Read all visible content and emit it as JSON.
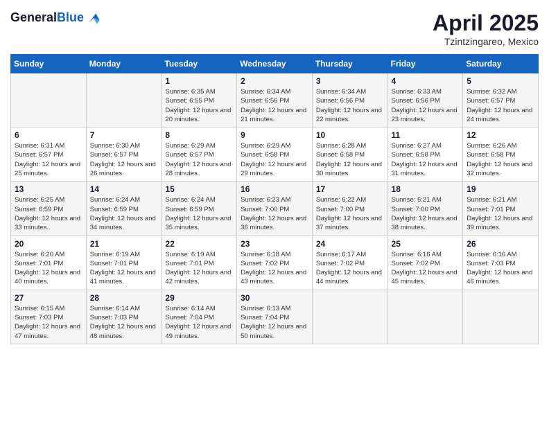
{
  "header": {
    "logo_general": "General",
    "logo_blue": "Blue",
    "title": "April 2025",
    "location": "Tzintzingareo, Mexico"
  },
  "weekdays": [
    "Sunday",
    "Monday",
    "Tuesday",
    "Wednesday",
    "Thursday",
    "Friday",
    "Saturday"
  ],
  "weeks": [
    [
      {
        "day": "",
        "info": ""
      },
      {
        "day": "",
        "info": ""
      },
      {
        "day": "1",
        "info": "Sunrise: 6:35 AM\nSunset: 6:55 PM\nDaylight: 12 hours and 20 minutes."
      },
      {
        "day": "2",
        "info": "Sunrise: 6:34 AM\nSunset: 6:56 PM\nDaylight: 12 hours and 21 minutes."
      },
      {
        "day": "3",
        "info": "Sunrise: 6:34 AM\nSunset: 6:56 PM\nDaylight: 12 hours and 22 minutes."
      },
      {
        "day": "4",
        "info": "Sunrise: 6:33 AM\nSunset: 6:56 PM\nDaylight: 12 hours and 23 minutes."
      },
      {
        "day": "5",
        "info": "Sunrise: 6:32 AM\nSunset: 6:57 PM\nDaylight: 12 hours and 24 minutes."
      }
    ],
    [
      {
        "day": "6",
        "info": "Sunrise: 6:31 AM\nSunset: 6:57 PM\nDaylight: 12 hours and 25 minutes."
      },
      {
        "day": "7",
        "info": "Sunrise: 6:30 AM\nSunset: 6:57 PM\nDaylight: 12 hours and 26 minutes."
      },
      {
        "day": "8",
        "info": "Sunrise: 6:29 AM\nSunset: 6:57 PM\nDaylight: 12 hours and 28 minutes."
      },
      {
        "day": "9",
        "info": "Sunrise: 6:29 AM\nSunset: 6:58 PM\nDaylight: 12 hours and 29 minutes."
      },
      {
        "day": "10",
        "info": "Sunrise: 6:28 AM\nSunset: 6:58 PM\nDaylight: 12 hours and 30 minutes."
      },
      {
        "day": "11",
        "info": "Sunrise: 6:27 AM\nSunset: 6:58 PM\nDaylight: 12 hours and 31 minutes."
      },
      {
        "day": "12",
        "info": "Sunrise: 6:26 AM\nSunset: 6:58 PM\nDaylight: 12 hours and 32 minutes."
      }
    ],
    [
      {
        "day": "13",
        "info": "Sunrise: 6:25 AM\nSunset: 6:59 PM\nDaylight: 12 hours and 33 minutes."
      },
      {
        "day": "14",
        "info": "Sunrise: 6:24 AM\nSunset: 6:59 PM\nDaylight: 12 hours and 34 minutes."
      },
      {
        "day": "15",
        "info": "Sunrise: 6:24 AM\nSunset: 6:59 PM\nDaylight: 12 hours and 35 minutes."
      },
      {
        "day": "16",
        "info": "Sunrise: 6:23 AM\nSunset: 7:00 PM\nDaylight: 12 hours and 36 minutes."
      },
      {
        "day": "17",
        "info": "Sunrise: 6:22 AM\nSunset: 7:00 PM\nDaylight: 12 hours and 37 minutes."
      },
      {
        "day": "18",
        "info": "Sunrise: 6:21 AM\nSunset: 7:00 PM\nDaylight: 12 hours and 38 minutes."
      },
      {
        "day": "19",
        "info": "Sunrise: 6:21 AM\nSunset: 7:01 PM\nDaylight: 12 hours and 39 minutes."
      }
    ],
    [
      {
        "day": "20",
        "info": "Sunrise: 6:20 AM\nSunset: 7:01 PM\nDaylight: 12 hours and 40 minutes."
      },
      {
        "day": "21",
        "info": "Sunrise: 6:19 AM\nSunset: 7:01 PM\nDaylight: 12 hours and 41 minutes."
      },
      {
        "day": "22",
        "info": "Sunrise: 6:19 AM\nSunset: 7:01 PM\nDaylight: 12 hours and 42 minutes."
      },
      {
        "day": "23",
        "info": "Sunrise: 6:18 AM\nSunset: 7:02 PM\nDaylight: 12 hours and 43 minutes."
      },
      {
        "day": "24",
        "info": "Sunrise: 6:17 AM\nSunset: 7:02 PM\nDaylight: 12 hours and 44 minutes."
      },
      {
        "day": "25",
        "info": "Sunrise: 6:16 AM\nSunset: 7:02 PM\nDaylight: 12 hours and 45 minutes."
      },
      {
        "day": "26",
        "info": "Sunrise: 6:16 AM\nSunset: 7:03 PM\nDaylight: 12 hours and 46 minutes."
      }
    ],
    [
      {
        "day": "27",
        "info": "Sunrise: 6:15 AM\nSunset: 7:03 PM\nDaylight: 12 hours and 47 minutes."
      },
      {
        "day": "28",
        "info": "Sunrise: 6:14 AM\nSunset: 7:03 PM\nDaylight: 12 hours and 48 minutes."
      },
      {
        "day": "29",
        "info": "Sunrise: 6:14 AM\nSunset: 7:04 PM\nDaylight: 12 hours and 49 minutes."
      },
      {
        "day": "30",
        "info": "Sunrise: 6:13 AM\nSunset: 7:04 PM\nDaylight: 12 hours and 50 minutes."
      },
      {
        "day": "",
        "info": ""
      },
      {
        "day": "",
        "info": ""
      },
      {
        "day": "",
        "info": ""
      }
    ]
  ]
}
